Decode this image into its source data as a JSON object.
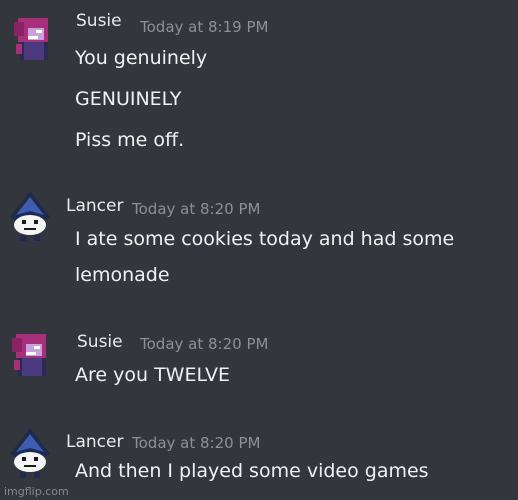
{
  "messages": [
    {
      "author": "Susie",
      "timestamp": "Today at 8:19 PM",
      "avatar_icon": "susie-avatar-icon",
      "lines": [
        "You genuinely",
        "GENUINELY",
        "Piss me off."
      ]
    },
    {
      "author": "Lancer",
      "timestamp": "Today at 8:20 PM",
      "avatar_icon": "lancer-avatar-icon",
      "lines": [
        "I ate some cookies today and had some",
        "lemonade"
      ]
    },
    {
      "author": "Susie",
      "timestamp": "Today at 8:20 PM",
      "avatar_icon": "susie-avatar-icon",
      "lines": [
        "Are you TWELVE"
      ]
    },
    {
      "author": "Lancer",
      "timestamp": "Today at 8:20 PM",
      "avatar_icon": "lancer-avatar-icon",
      "lines": [
        "And then I played some video games"
      ]
    }
  ],
  "watermark": "imgflip.com",
  "colors": {
    "background": "#33363c",
    "author_name": "#e9e9ea",
    "timestamp": "#8d9096",
    "message_text": "#f0f1f2"
  }
}
